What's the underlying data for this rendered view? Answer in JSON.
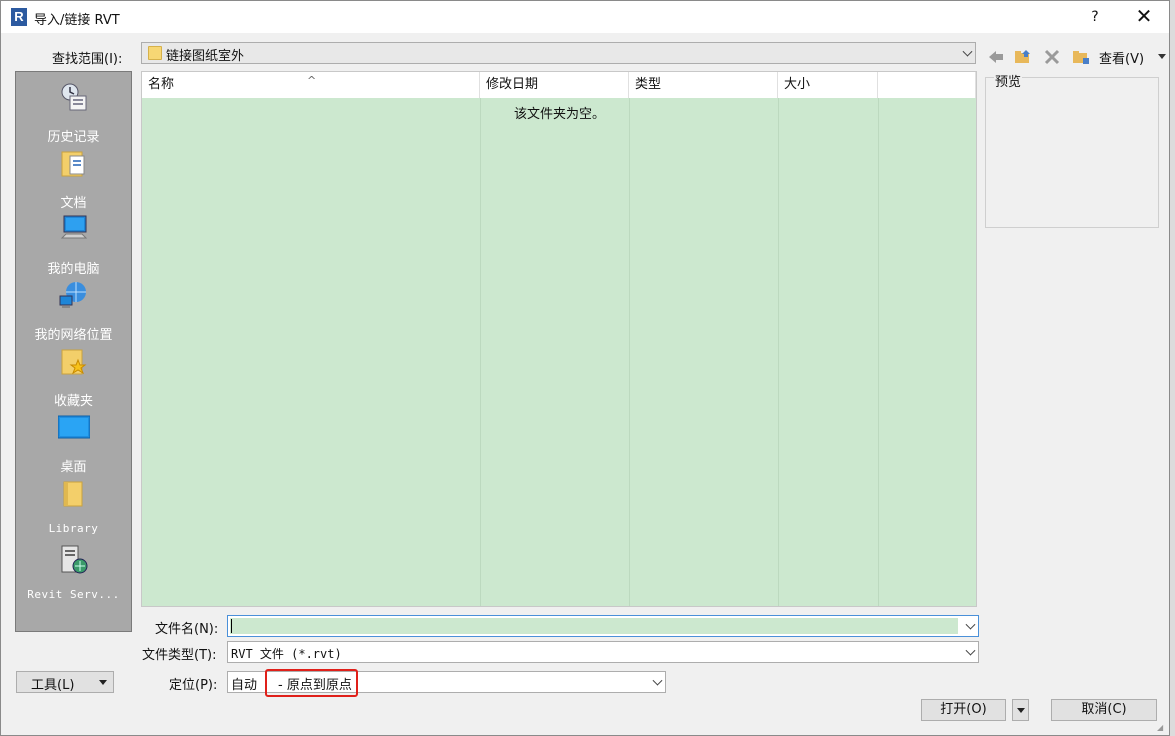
{
  "window": {
    "title": "导入/链接 RVT",
    "help_label": "?",
    "close_label": "✕"
  },
  "lookin": {
    "label": "查找范围(I):",
    "value": "链接图纸室外"
  },
  "toolbar": {
    "icons": [
      "back-icon",
      "up-folder-icon",
      "delete-icon",
      "new-folder-icon"
    ],
    "view_label": "查看(V)"
  },
  "places": [
    {
      "label": "历史记录",
      "icon": "history-icon"
    },
    {
      "label": "文档",
      "icon": "documents-icon"
    },
    {
      "label": "我的电脑",
      "icon": "computer-icon"
    },
    {
      "label": "我的网络位置",
      "icon": "network-icon"
    },
    {
      "label": "收藏夹",
      "icon": "favorites-icon"
    },
    {
      "label": "桌面",
      "icon": "desktop-icon"
    },
    {
      "label": "Library",
      "icon": "library-icon"
    },
    {
      "label": "Revit Serv...",
      "icon": "revit-server-icon"
    }
  ],
  "filelist": {
    "columns": [
      "名称",
      "修改日期",
      "类型",
      "大小"
    ],
    "empty_message": "该文件夹为空。"
  },
  "preview": {
    "label": "预览"
  },
  "filename": {
    "label": "文件名(N):",
    "value": ""
  },
  "filetype": {
    "label": "文件类型(T):",
    "value": "RVT 文件 (*.rvt)"
  },
  "positioning": {
    "label": "定位(P):",
    "value_prefix": "自动",
    "value": "- 原点到原点"
  },
  "buttons": {
    "tools": "工具(L)",
    "open": "打开(O)",
    "cancel": "取消(C)"
  },
  "colors": {
    "list_background": "#cce8cf",
    "places_background": "#a8a8a8",
    "highlight": "#e0201a"
  }
}
